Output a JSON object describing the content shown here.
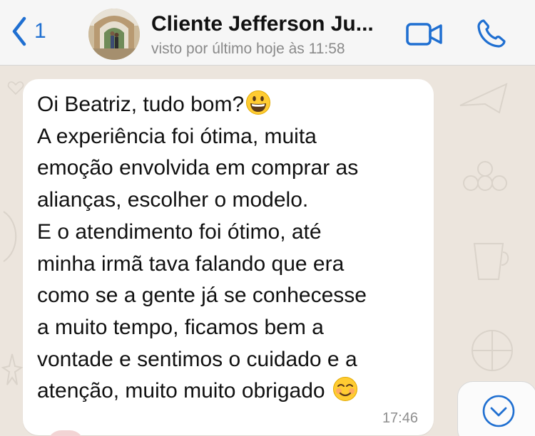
{
  "header": {
    "back_count": "1",
    "contact_name": "Cliente Jefferson Ju...",
    "last_seen": "visto por último hoje às 11:58"
  },
  "message": {
    "lines": [
      "Oi Beatriz, tudo bom?",
      "A experiência foi ótima, muita",
      "emoção envolvida em comprar as",
      "alianças, escolher o modelo.",
      "E o atendimento foi ótimo, até",
      "minha irmã tava falando que era",
      "como se a gente já se conhecesse",
      "a muito tempo, ficamos bem a",
      "vontade e sentimos o cuidado e a",
      "atenção, muito muito obrigado"
    ],
    "time": "17:46",
    "emojis": [
      "grinning-face",
      "smiling-face"
    ]
  },
  "colors": {
    "accent": "#1f6fd1",
    "chat_background": "#ece5dd",
    "bubble": "#ffffff"
  }
}
